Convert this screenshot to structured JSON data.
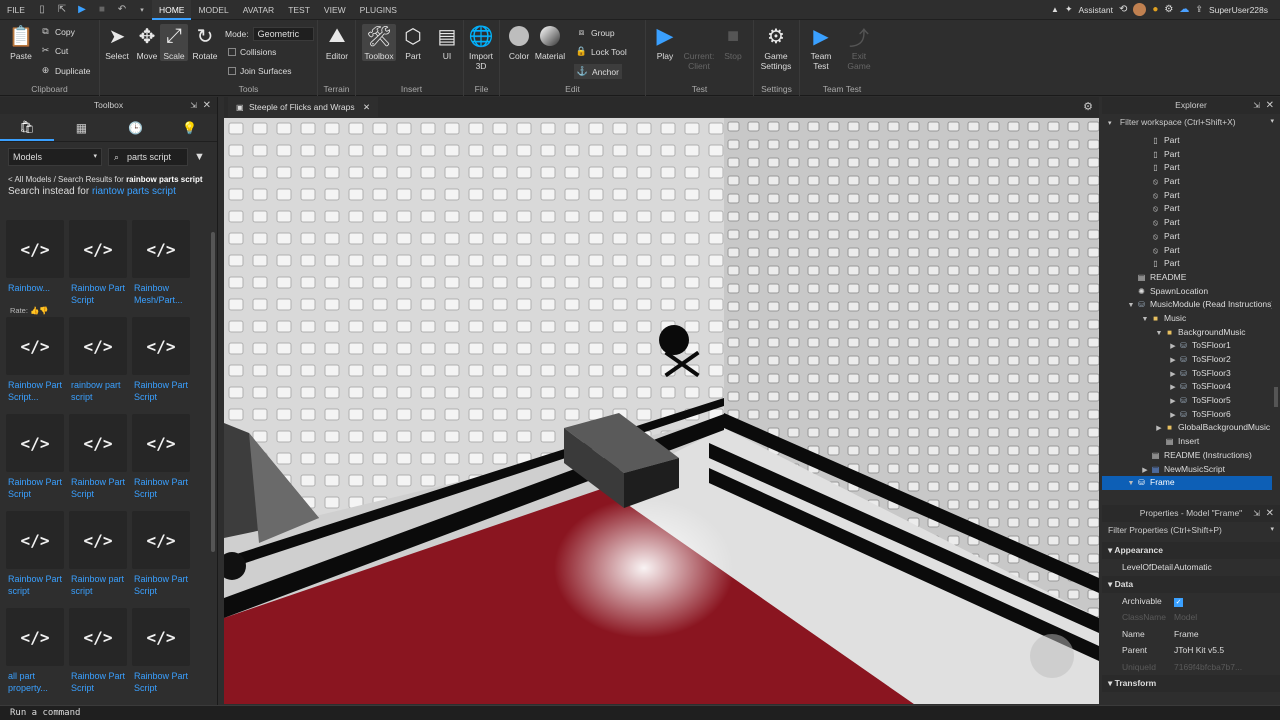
{
  "menu": {
    "file": "FILE",
    "tabs": [
      "HOME",
      "MODEL",
      "AVATAR",
      "TEST",
      "VIEW",
      "PLUGINS"
    ],
    "active_tab": "HOME",
    "assistant": "Assistant",
    "username": "SuperUser228s"
  },
  "ribbon": {
    "clipboard": {
      "label": "Clipboard",
      "paste": "Paste",
      "copy": "Copy",
      "cut": "Cut",
      "duplicate": "Duplicate"
    },
    "tools": {
      "label": "Tools",
      "select": "Select",
      "move": "Move",
      "scale": "Scale",
      "rotate": "Rotate",
      "mode_label": "Mode:",
      "mode_value": "Geometric",
      "collisions": "Collisions",
      "join_surfaces": "Join Surfaces"
    },
    "terrain": {
      "label": "Terrain",
      "editor": "Editor"
    },
    "insert": {
      "label": "Insert",
      "toolbox": "Toolbox",
      "part": "Part",
      "ui": "UI"
    },
    "file": {
      "label": "File",
      "import3d": "Import 3D"
    },
    "edit": {
      "label": "Edit",
      "color": "Color",
      "material": "Material",
      "group": "Group",
      "lock_tool": "Lock Tool",
      "anchor": "Anchor"
    },
    "test": {
      "label": "Test",
      "play": "Play",
      "current_client": "Current: Client",
      "stop": "Stop"
    },
    "settings": {
      "label": "Settings",
      "game_settings": "Game Settings"
    },
    "team_test": {
      "label": "Team Test",
      "team_test": "Team Test",
      "exit_game": "Exit Game"
    }
  },
  "toolbox": {
    "title": "Toolbox",
    "category": "Models",
    "search_value": "parts script",
    "breadcrumb_prefix": "< All Models / Search Results for ",
    "breadcrumb_query": "rainbow parts script",
    "search_instead_prefix": "Search instead for ",
    "search_instead_link": "riantow parts script",
    "rate_label": "Rate:",
    "items": [
      "Rainbow...",
      "Rainbow Part Script",
      "Rainbow Mesh/Part...",
      "Rainbow Part Script...",
      "rainbow part script",
      "Rainbow Part Script",
      "Rainbow Part Script",
      "Rainbow Part Script",
      "Rainbow Part Script",
      "Rainbow Part script",
      "Rainbow part script",
      "Rainbow Part Script",
      "all part property...",
      "Rainbow Part Script",
      "Rainbow Part Script"
    ]
  },
  "document": {
    "tab_title": "Steeple of Flicks and Wraps"
  },
  "explorer": {
    "title": "Explorer",
    "filter_placeholder": "Filter workspace (Ctrl+Shift+X)",
    "rows": [
      {
        "label": "Part",
        "icon": "part",
        "depth": 4
      },
      {
        "label": "Part",
        "icon": "part",
        "depth": 4
      },
      {
        "label": "Part",
        "icon": "part",
        "depth": 4
      },
      {
        "label": "Part",
        "icon": "negate",
        "depth": 4
      },
      {
        "label": "Part",
        "icon": "negate",
        "depth": 4
      },
      {
        "label": "Part",
        "icon": "negate",
        "depth": 4
      },
      {
        "label": "Part",
        "icon": "negate",
        "depth": 4
      },
      {
        "label": "Part",
        "icon": "negate",
        "depth": 4
      },
      {
        "label": "Part",
        "icon": "negate",
        "depth": 4
      },
      {
        "label": "Part",
        "icon": "part",
        "depth": 4
      },
      {
        "label": "README",
        "icon": "script",
        "depth": 3
      },
      {
        "label": "SpawnLocation",
        "icon": "spawn",
        "depth": 3
      },
      {
        "label": "MusicModule (Read Instructions)",
        "icon": "model",
        "depth": 3,
        "twisty": "open"
      },
      {
        "label": "Music",
        "icon": "folder",
        "depth": 4,
        "twisty": "open"
      },
      {
        "label": "BackgroundMusic",
        "icon": "folder",
        "depth": 5,
        "twisty": "open"
      },
      {
        "label": "ToSFloor1",
        "icon": "model",
        "depth": 6,
        "twisty": "closed"
      },
      {
        "label": "ToSFloor2",
        "icon": "model",
        "depth": 6,
        "twisty": "closed"
      },
      {
        "label": "ToSFloor3",
        "icon": "model",
        "depth": 6,
        "twisty": "closed"
      },
      {
        "label": "ToSFloor4",
        "icon": "model",
        "depth": 6,
        "twisty": "closed"
      },
      {
        "label": "ToSFloor5",
        "icon": "model",
        "depth": 6,
        "twisty": "closed"
      },
      {
        "label": "ToSFloor6",
        "icon": "model",
        "depth": 6,
        "twisty": "closed"
      },
      {
        "label": "GlobalBackgroundMusic",
        "icon": "folder",
        "depth": 5,
        "twisty": "closed"
      },
      {
        "label": "Insert",
        "icon": "script",
        "depth": 5
      },
      {
        "label": "README (Instructions)",
        "icon": "script",
        "depth": 4
      },
      {
        "label": "NewMusicScript",
        "icon": "localscript",
        "depth": 4,
        "twisty": "closed"
      },
      {
        "label": "Frame",
        "icon": "model",
        "depth": 3,
        "twisty": "open",
        "selected": true
      }
    ]
  },
  "properties": {
    "title": "Properties - Model \"Frame\"",
    "filter_placeholder": "Filter Properties (Ctrl+Shift+P)",
    "sections": [
      {
        "name": "Appearance",
        "rows": [
          {
            "k": "LevelOfDetail",
            "v": "Automatic"
          }
        ]
      },
      {
        "name": "Data",
        "rows": [
          {
            "k": "Archivable",
            "v": "",
            "checkbox": true
          },
          {
            "k": "ClassName",
            "v": "Model",
            "dim": true
          },
          {
            "k": "Name",
            "v": "Frame"
          },
          {
            "k": "Parent",
            "v": "JToH Kit v5.5"
          },
          {
            "k": "UniqueId",
            "v": "7169f4bfcba7b7...",
            "dim": true
          }
        ]
      },
      {
        "name": "Transform",
        "rows": []
      }
    ]
  },
  "command_bar": {
    "placeholder": "Run a command"
  },
  "colors": {
    "accent": "#3aa0ff",
    "selection": "#0d5fb6",
    "floor_red": "#8a1520"
  }
}
